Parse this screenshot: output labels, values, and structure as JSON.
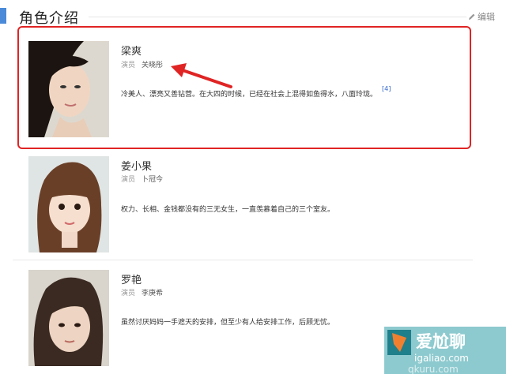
{
  "header": {
    "title": "角色介绍",
    "edit_label": "编辑"
  },
  "roles": [
    {
      "name": "梁爽",
      "role_label": "演员",
      "actor": "关晓彤",
      "description": "冷美人、漂亮又善钻营。在大四的时候，已经在社会上混得如鱼得水，八面玲珑。",
      "reference": "[4]"
    },
    {
      "name": "姜小果",
      "role_label": "演员",
      "actor": "卜冠今",
      "description": "权力、长相、金钱都没有的三无女生，一直羡慕着自己的三个室友。"
    },
    {
      "name": "罗艳",
      "role_label": "演员",
      "actor": "李庚希",
      "description": "虽然讨厌妈妈一手遮天的安排，但至少有人给安排工作，后顾无忧。"
    }
  ],
  "watermark": {
    "brand": "爱尬聊",
    "url": "igaliao.com",
    "sub": "qkuru.com"
  },
  "colors": {
    "accent": "#4a8ad8",
    "highlight": "#e02424",
    "link": "#3366cc"
  }
}
